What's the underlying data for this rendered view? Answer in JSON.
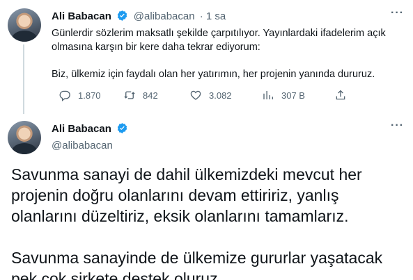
{
  "tweet1": {
    "name": "Ali Babacan",
    "handle": "@alibabacan",
    "time": " · 1 sa",
    "paragraphs": [
      "Günlerdir sözlerim maksatlı şekilde çarpıtılıyor. Yayınlardaki ifadelerim açık olmasına karşın bir kere daha tekrar ediyorum:",
      "Biz, ülkemiz için faydalı olan her yatırımın, her projenin yanında dururuz."
    ],
    "actions": {
      "replies": "1.870",
      "retweets": "842",
      "likes": "3.082",
      "views": "307 B"
    }
  },
  "tweet2": {
    "name": "Ali Babacan",
    "handle": "@alibabacan",
    "paragraphs": [
      "Savunma sanayi de dahil ülkemizdeki mevcut her projenin doğru olanlarını devam ettiririz, yanlış olanlarını düzeltiriz, eksik olanlarını tamamlarız.",
      "Savunma sanayinde de ülkemize gururlar yaşatacak pek çok şirkete destek oluruz."
    ]
  },
  "icons": {
    "verified_color": "#1d9bf0",
    "muted_color": "#536471"
  }
}
